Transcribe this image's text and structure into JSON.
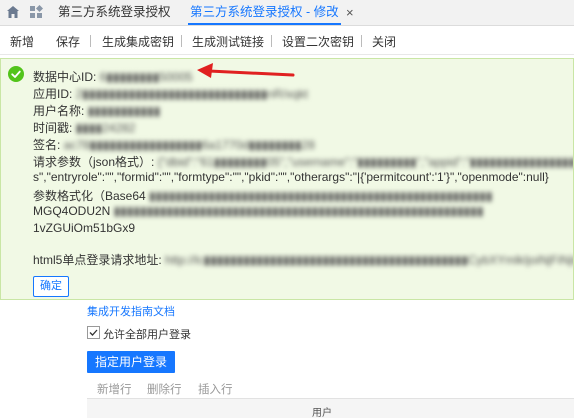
{
  "tabs": [
    {
      "label": "第三方系统登录授权"
    },
    {
      "label": "第三方系统登录授权 - 修改"
    }
  ],
  "close_glyph": "×",
  "toolbar": [
    "新增",
    "保存",
    "生成集成密钥",
    "生成测试链接",
    "设置二次密钥",
    "关闭"
  ],
  "notice": {
    "lines": [
      {
        "label": "数据中心ID:",
        "value": "6▮▮▮▮▮▮▮▮50005"
      },
      {
        "label": "应用ID:",
        "value": "2▮▮▮▮▮▮▮▮▮▮▮▮▮▮▮▮▮▮▮▮▮▮▮▮▮▮▮▮nR/xqkt"
      },
      {
        "label": "用户名称:",
        "value": "▮▮▮▮▮▮▮▮▮▮▮"
      },
      {
        "label": "时间戳:",
        "value": "▮▮▮▮24282"
      },
      {
        "label": "签名:",
        "value": "ac78▮▮▮▮▮▮▮▮▮▮▮▮▮▮▮▮▮6a1770d▮▮▮▮▮▮▮▮28"
      },
      {
        "label": "请求参数（json格式）:",
        "value": "{\"dbid\":\"61▮▮▮▮▮▮▮▮05\",\"username\":\"▮▮▮▮▮▮▮▮▮\",\"appid\":\"▮▮▮▮▮▮▮▮▮▮▮▮▮▮▮▮\""
      },
      {
        "label": "",
        "value": "s\",\"entryrole\":\"\",\"formid\":\"\",\"formtype\":\"\",\"pkid\":\"\",\"otherargs\":\"|{'permitcount':'1'}\",\"openmode\":null}"
      },
      {
        "label": "参数格式化（Base64",
        "value": "▮▮▮▮▮▮▮▮▮▮▮▮▮▮▮▮▮▮▮▮▮▮▮▮▮▮▮▮▮▮▮▮▮▮▮▮▮▮▮▮▮▮▮▮▮▮▮▮▮▮▮▮"
      },
      {
        "label": "MGQ4ODU2N",
        "value": "▮▮▮▮▮▮▮▮▮▮▮▮▮▮▮▮▮▮▮▮▮▮▮▮▮▮▮▮▮▮▮▮▮▮▮▮▮▮▮▮▮▮▮▮▮▮▮▮▮▮▮▮▮▮▮▮"
      },
      {
        "label": "1vZGUiOm51bGx9",
        "value": ""
      },
      {
        "label": "html5单点登录请求地址:",
        "value": "http://lc▮▮▮▮▮▮▮▮▮▮▮▮▮▮▮▮▮▮▮▮▮▮▮▮▮▮▮▮▮▮▮▮▮▮▮▮▮▮▮▮CybXYmlkIjoiNjFiNjiwN1g1N"
      }
    ],
    "confirm_label": "确定"
  },
  "doc_link": "集成开发指南文档",
  "allow_all_label": "允许全部用户登录",
  "assign_button": "指定用户登录",
  "row_tools": [
    "新增行",
    "删除行",
    "插入行"
  ],
  "table_header": "用户",
  "colors": {
    "accent": "#1677ff",
    "notice_bg": "#f1f9e5",
    "success": "#52c41a",
    "arrow": "#e02020"
  }
}
